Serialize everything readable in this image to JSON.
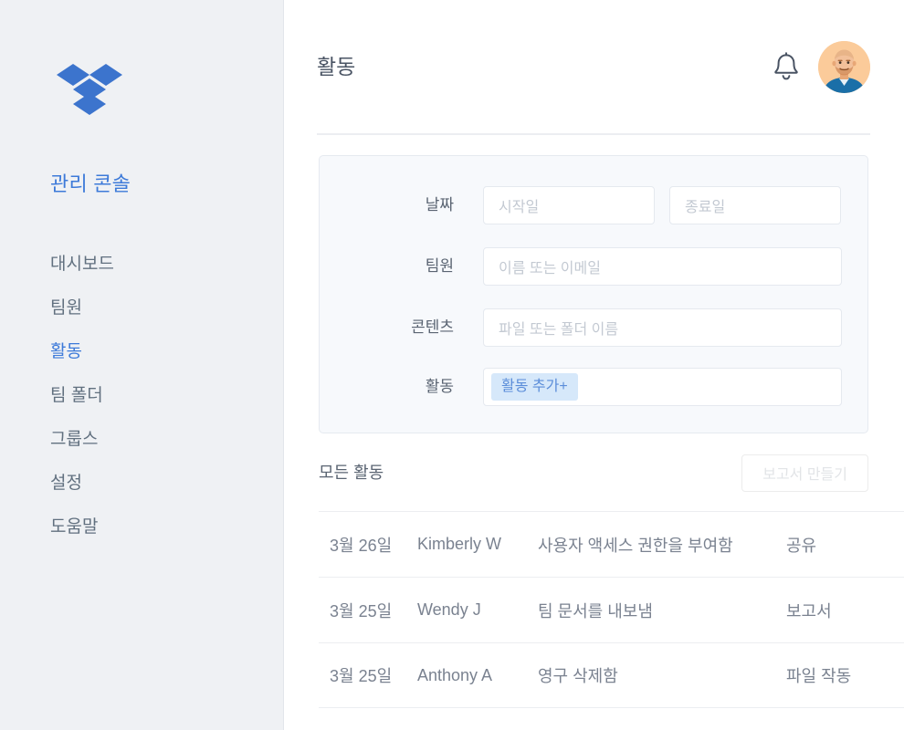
{
  "sidebar": {
    "logo_icon": "dropbox-logo",
    "console_title": "관리 콘솔",
    "items": [
      {
        "label": "대시보드",
        "active": false
      },
      {
        "label": "팀원",
        "active": false
      },
      {
        "label": "활동",
        "active": true
      },
      {
        "label": "팀 폴더",
        "active": false
      },
      {
        "label": "그룹스",
        "active": false
      },
      {
        "label": "설정",
        "active": false
      },
      {
        "label": "도움말",
        "active": false
      }
    ]
  },
  "header": {
    "title": "활동",
    "bell_icon": "bell-icon",
    "avatar_icon": "user-avatar"
  },
  "filters": {
    "date": {
      "label": "날짜",
      "start_placeholder": "시작일",
      "start_value": "",
      "end_placeholder": "종료일",
      "end_value": ""
    },
    "member": {
      "label": "팀원",
      "placeholder": "이름 또는 이메일",
      "value": ""
    },
    "content": {
      "label": "콘텐츠",
      "placeholder": "파일 또는 폴더 이름",
      "value": ""
    },
    "activity": {
      "label": "활동",
      "chip_label": "활동 추가+",
      "value": ""
    }
  },
  "table": {
    "title": "모든 활동",
    "report_button": "보고서 만들기",
    "rows": [
      {
        "date": "3월 26일",
        "member": "Kimberly W",
        "action": "사용자 액세스 권한을 부여함",
        "category": "공유"
      },
      {
        "date": "3월 25일",
        "member": "Wendy J",
        "action": "팀 문서를 내보냄",
        "category": "보고서"
      },
      {
        "date": "3월 25일",
        "member": "Anthony A",
        "action": "영구 삭제함",
        "category": "파일 작동"
      }
    ]
  },
  "colors": {
    "brand_blue": "#3d7ad9",
    "sidebar_bg": "#eff1f4",
    "panel_bg": "#f7f9fc",
    "chip_bg": "#d6e8fa",
    "chip_text": "#5b8dd9",
    "text_gray": "#61707f",
    "placeholder_gray": "#c3c9d2",
    "avatar_bg": "#fbcb9a"
  }
}
